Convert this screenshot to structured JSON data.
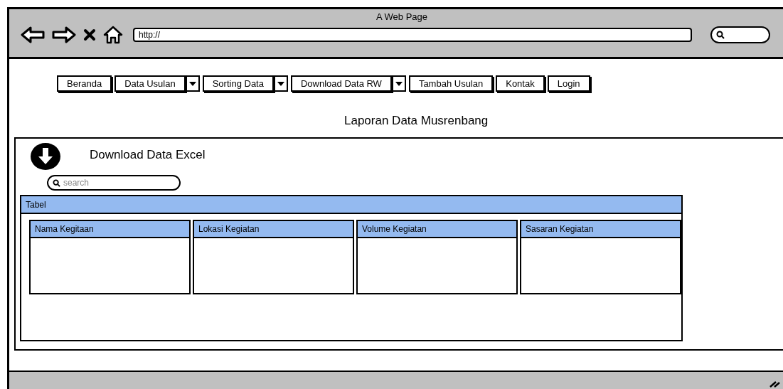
{
  "window": {
    "title": "A Web Page",
    "url": "http://"
  },
  "nav": [
    {
      "label": "Beranda",
      "kind": "button"
    },
    {
      "label": "Data Usulan",
      "kind": "dropdown"
    },
    {
      "label": "Sorting Data",
      "kind": "dropdown"
    },
    {
      "label": "Download Data RW",
      "kind": "dropdown"
    },
    {
      "label": "Tambah Usulan",
      "kind": "button"
    },
    {
      "label": "Kontak",
      "kind": "button"
    },
    {
      "label": "Login",
      "kind": "button"
    }
  ],
  "page_title": "Laporan Data Musrenbang",
  "download": {
    "label": "Download Data Excel"
  },
  "search": {
    "placeholder": "search"
  },
  "table": {
    "title": "Tabel",
    "columns": [
      "Nama Kegitaan",
      "Lokasi Kegiatan",
      "Volume Kegiatan",
      "Sasaran Kegiatan"
    ]
  }
}
